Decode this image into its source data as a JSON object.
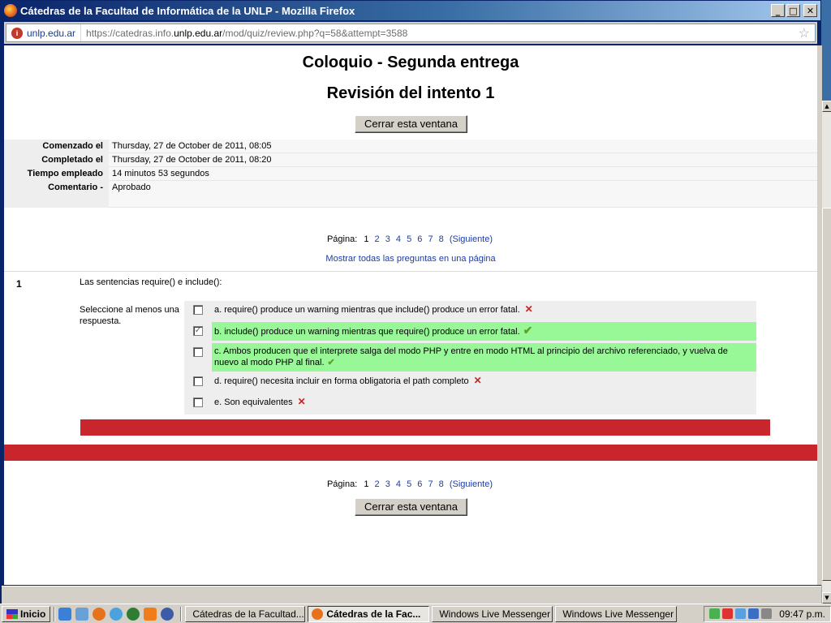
{
  "window": {
    "title": "Cátedras de la Facultad de Informática de la UNLP - Mozilla Firefox",
    "buttons": {
      "minimize": "_",
      "maximize": "□",
      "close": "✕"
    }
  },
  "urlbar": {
    "site_identity": "unlp.edu.ar",
    "favicon_letter": "i",
    "url_prefix": "https://catedras.info.",
    "url_domain": "unlp.edu.ar",
    "url_suffix": "/mod/quiz/review.php?q=58&attempt=3588",
    "bookmark_star": "☆"
  },
  "page": {
    "title": "Coloquio - Segunda entrega",
    "subtitle": "Revisión del intento 1",
    "close_button": "Cerrar esta ventana",
    "info": [
      {
        "label": "Comenzado el",
        "value": "Thursday, 27 de October de 2011, 08:05"
      },
      {
        "label": "Completado el",
        "value": "Thursday, 27 de October de 2011, 08:20"
      },
      {
        "label": "Tiempo empleado",
        "value": "14 minutos 53 segundos"
      },
      {
        "label": "Comentario -",
        "value": "Aprobado"
      }
    ],
    "paging": {
      "label": "Página:",
      "current": "1",
      "pages": [
        "2",
        "3",
        "4",
        "5",
        "6",
        "7",
        "8"
      ],
      "next": "(Siguiente)"
    },
    "show_all": "Mostrar todas las preguntas en una página",
    "question": {
      "number": "1",
      "text": "Las sentencias require() e include():",
      "prompt": "Seleccione al menos una respuesta.",
      "answers": [
        {
          "text": "a. require() produce un warning mientras que include() produce un error fatal.",
          "checked": false,
          "correct": false,
          "mark": "✕"
        },
        {
          "text": "b. include() produce un warning mientras que require() produce un error fatal.",
          "checked": true,
          "correct": true,
          "mark": "✔"
        },
        {
          "text": "c. Ambos producen que el interprete salga del modo PHP y entre en modo HTML al principio del archivo referenciado, y vuelva de nuevo al modo PHP al final.",
          "checked": false,
          "correct": true,
          "mark": "✔"
        },
        {
          "text": "d. require() necesita incluir en forma obligatoria el path completo",
          "checked": false,
          "correct": false,
          "mark": "✕"
        },
        {
          "text": "e. Son equivalentes",
          "checked": false,
          "correct": false,
          "mark": "✕"
        }
      ],
      "check_mark": "✓"
    }
  },
  "taskbar": {
    "start": "Inicio",
    "tasks": [
      "Cátedras de la Facultad...",
      "Cátedras de la Fac...",
      "Windows Live Messenger",
      "Windows Live Messenger"
    ],
    "clock": "09:47 p.m."
  },
  "colors": {
    "correct_bg": "#98f898",
    "error_bar": "#c9252d",
    "link": "#1a3da8"
  }
}
